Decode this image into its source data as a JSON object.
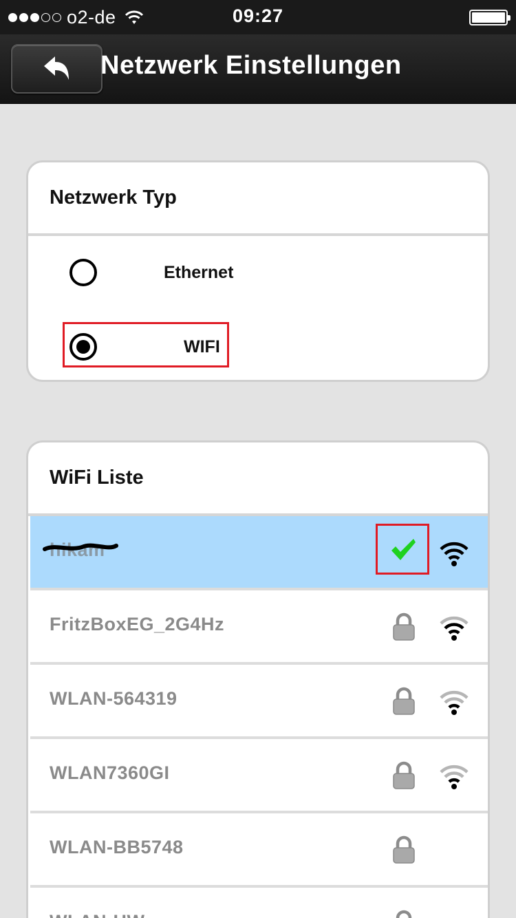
{
  "status_bar": {
    "carrier": "o2-de",
    "time": "09:27",
    "signal_bars": 3,
    "signal_total": 5
  },
  "nav": {
    "title": "Netzwerk Einstellungen",
    "back_icon": "back-arrow-icon"
  },
  "network_type": {
    "header": "Netzwerk Typ",
    "options": [
      {
        "label": "Ethernet",
        "selected": false
      },
      {
        "label": "WIFI",
        "selected": true
      }
    ]
  },
  "wifi_list": {
    "header": "WiFi Liste",
    "networks": [
      {
        "ssid": "hikam",
        "redacted": true,
        "connected": true,
        "locked": false,
        "signal": "strong"
      },
      {
        "ssid": "FritzBoxEG_2G4Hz",
        "connected": false,
        "locked": true,
        "signal": "medium"
      },
      {
        "ssid": "WLAN-564319",
        "connected": false,
        "locked": true,
        "signal": "medium"
      },
      {
        "ssid": "WLAN7360GI",
        "connected": false,
        "locked": true,
        "signal": "medium"
      },
      {
        "ssid": "WLAN-BB5748",
        "connected": false,
        "locked": true,
        "signal": "none"
      },
      {
        "ssid": "WLAN-HW",
        "connected": false,
        "locked": true,
        "signal": "none"
      }
    ]
  },
  "colors": {
    "selected_row": "#acdafd",
    "highlight": "#e01b24",
    "check": "#1fd11f"
  }
}
